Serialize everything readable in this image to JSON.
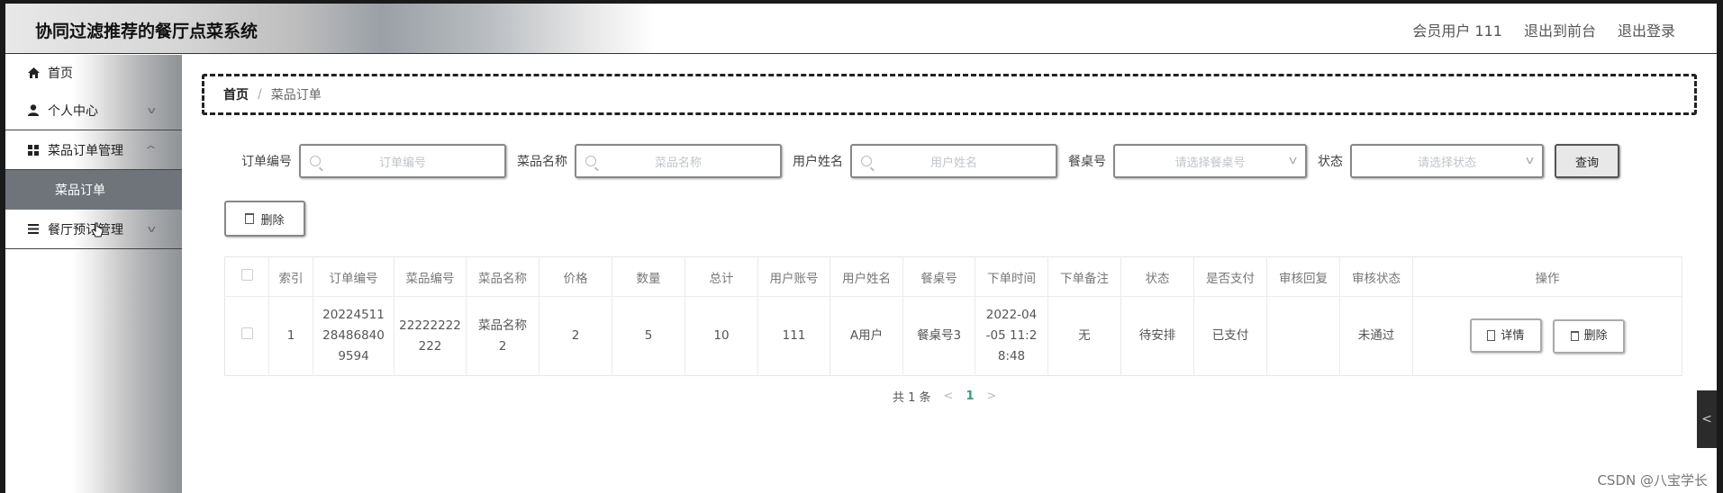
{
  "header": {
    "app_title": "协同过滤推荐的餐厅点菜系统",
    "user_label": "会员用户 111",
    "to_front": "退出到前台",
    "logout": "退出登录"
  },
  "sidebar": {
    "items": [
      {
        "label": "首页",
        "icon": "home-icon"
      },
      {
        "label": "个人中心",
        "icon": "user-icon"
      },
      {
        "label": "菜品订单管理",
        "icon": "grid-icon"
      },
      {
        "label": "餐厅预订管理",
        "icon": "list-icon"
      }
    ],
    "active_sub": "菜品订单"
  },
  "breadcrumb": {
    "home": "首页",
    "separator": "/",
    "current": "菜品订单"
  },
  "filters": {
    "order_no_label": "订单编号",
    "order_no_placeholder": "订单编号",
    "dish_name_label": "菜品名称",
    "dish_name_placeholder": "菜品名称",
    "user_name_label": "用户姓名",
    "user_name_placeholder": "用户姓名",
    "table_label": "餐桌号",
    "table_placeholder": "请选择餐桌号",
    "status_label": "状态",
    "status_placeholder": "请选择状态",
    "query_button": "查询"
  },
  "actions": {
    "delete_button": "删除"
  },
  "table": {
    "columns": [
      "索引",
      "订单编号",
      "菜品编号",
      "菜品名称",
      "价格",
      "数量",
      "总计",
      "用户账号",
      "用户姓名",
      "餐桌号",
      "下单时间",
      "下单备注",
      "状态",
      "是否支付",
      "审核回复",
      "审核状态",
      "操作"
    ],
    "rows": [
      {
        "index": "1",
        "order_no": "202245112848684 09594",
        "order_no_lines": [
          "20224511",
          "28486840",
          "9594"
        ],
        "dish_no_lines": [
          "22222222",
          "222"
        ],
        "dish_name_lines": [
          "菜品名称",
          "2"
        ],
        "price": "2",
        "quantity": "5",
        "total": "10",
        "account": "111",
        "user_name": "A用户",
        "table_no": "餐桌号3",
        "time_lines": [
          "2022-04",
          "-05 11:2",
          "8:48"
        ],
        "remark": "无",
        "status": "待安排",
        "paid": "已支付",
        "reply": "",
        "review_status": "未通过",
        "detail_button": "详情",
        "delete_button": "删除"
      }
    ]
  },
  "pager": {
    "total": "共 1 条",
    "current_page": "1"
  },
  "watermark": "CSDN @八宝学长"
}
